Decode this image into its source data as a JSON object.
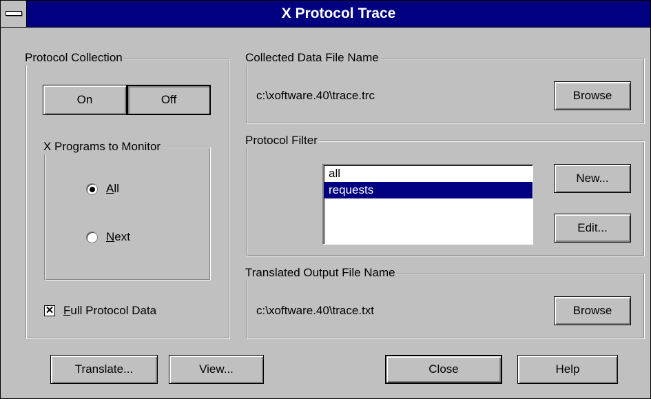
{
  "window": {
    "title": "X Protocol Trace"
  },
  "protocol_collection": {
    "label": "Protocol Collection",
    "on_label": "On",
    "off_label": "Off",
    "active": "Off"
  },
  "programs": {
    "label": "X Programs to Monitor",
    "all_mnemonic": "A",
    "all_rest": "ll",
    "next_mnemonic": "N",
    "next_rest": "ext",
    "selected": "All"
  },
  "full_protocol": {
    "mnemonic": "F",
    "rest": "ull Protocol Data",
    "checked": true,
    "mark": "✕"
  },
  "collected_file": {
    "label": "Collected Data File Name",
    "path": "c:\\xoftware.40\\trace.trc",
    "browse_label": "Browse"
  },
  "protocol_filter": {
    "label": "Protocol Filter",
    "items": [
      {
        "label": "all"
      },
      {
        "label": "requests"
      }
    ],
    "selected_index": 1,
    "new_label": "New...",
    "edit_label": "Edit..."
  },
  "translated_file": {
    "label": "Translated Output File Name",
    "path": "c:\\xoftware.40\\trace.txt",
    "browse_label": "Browse"
  },
  "buttons": {
    "translate": "Translate...",
    "view": "View...",
    "close": "Close",
    "help": "Help"
  }
}
